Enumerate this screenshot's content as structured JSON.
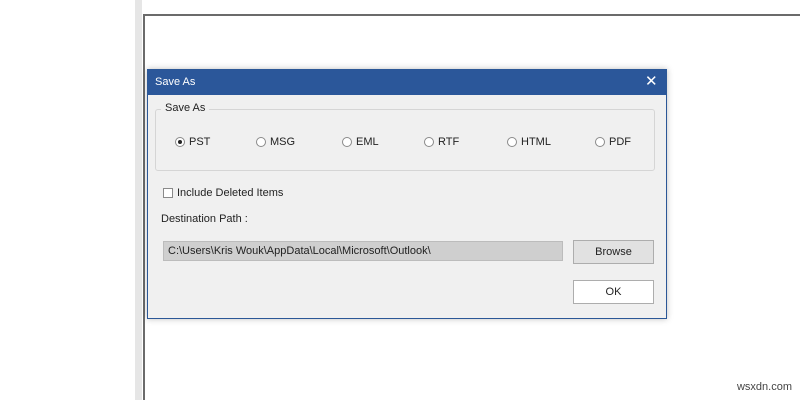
{
  "dialog": {
    "title": "Save As",
    "close_icon": "close-icon",
    "group_label": "Save As",
    "formats": [
      {
        "label": "PST",
        "selected": true
      },
      {
        "label": "MSG",
        "selected": false
      },
      {
        "label": "EML",
        "selected": false
      },
      {
        "label": "RTF",
        "selected": false
      },
      {
        "label": "HTML",
        "selected": false
      },
      {
        "label": "PDF",
        "selected": false
      }
    ],
    "include_deleted_label": "Include Deleted Items",
    "include_deleted_checked": false,
    "destination_label": "Destination Path :",
    "destination_path": "C:\\Users\\Kris Wouk\\AppData\\Local\\Microsoft\\Outlook\\",
    "browse_label": "Browse",
    "ok_label": "OK"
  },
  "colors": {
    "titlebar": "#2b579a",
    "dialog_bg": "#f0f0f0"
  },
  "watermark": "wsxdn.com"
}
